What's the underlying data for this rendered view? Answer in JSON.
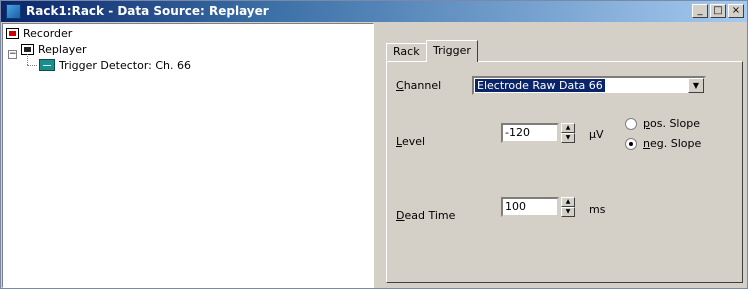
{
  "window": {
    "title": "Rack1:Rack - Data Source: Replayer",
    "minimize": "_",
    "maximize": "□",
    "close": "×"
  },
  "tree": {
    "expander": "−",
    "items": [
      {
        "label": "Recorder",
        "icon": "recorder-icon"
      },
      {
        "label": "Replayer",
        "icon": "replayer-icon"
      },
      {
        "label": "Trigger Detector: Ch. 66",
        "icon": "trigger-detector-icon"
      }
    ]
  },
  "tabs": [
    {
      "label": "Rack",
      "active": false
    },
    {
      "label": "Trigger",
      "active": true
    }
  ],
  "trigger": {
    "channel": {
      "label_first": "C",
      "label_rest": "hannel",
      "value": "Electrode Raw Data 66",
      "arrow": "▼"
    },
    "level": {
      "label_first": "L",
      "label_rest": "evel",
      "value": "-120",
      "unit": "µV"
    },
    "dead_time": {
      "label_first": "D",
      "label_rest": "ead Time",
      "value": "100",
      "unit": "ms"
    },
    "slope": {
      "pos": {
        "first": "p",
        "rest": "os. Slope",
        "selected": false
      },
      "neg": {
        "first": "n",
        "rest": "eg. Slope",
        "selected": true
      }
    },
    "spin_up": "▲",
    "spin_down": "▼"
  }
}
